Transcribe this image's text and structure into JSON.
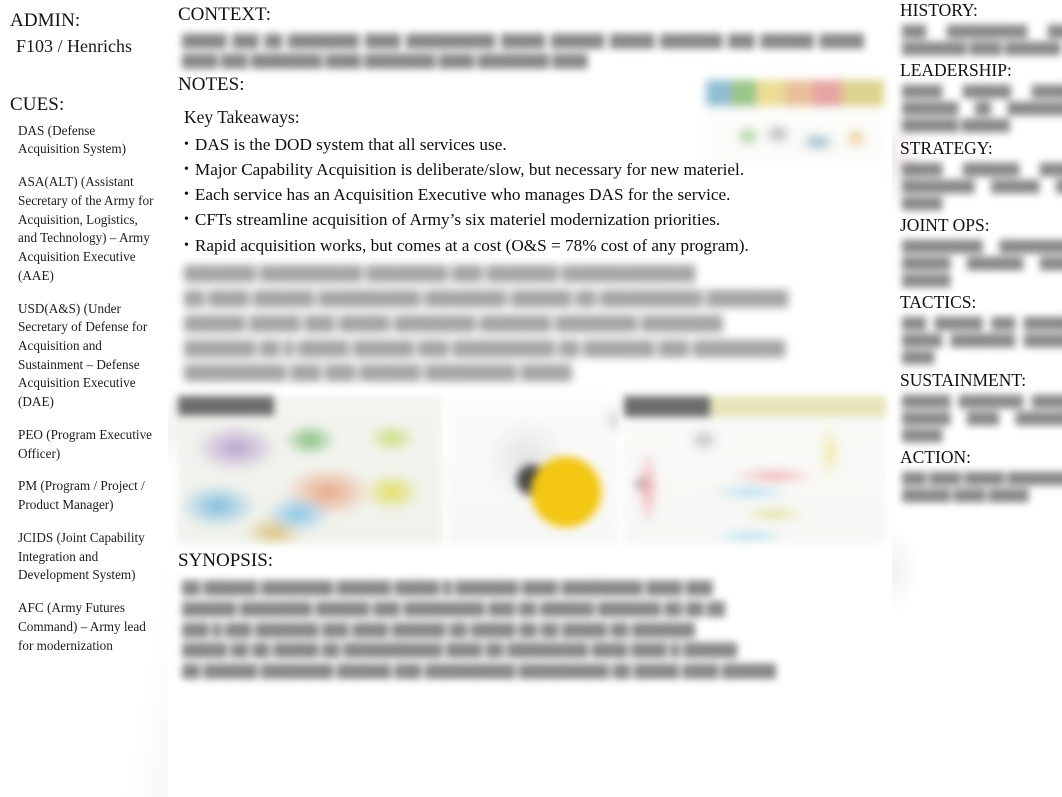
{
  "left": {
    "admin": {
      "header": "ADMIN:",
      "value": "F103 / Henrichs"
    },
    "cues": {
      "header": "CUES:",
      "items": [
        "DAS (Defense Acquisition System)",
        "ASA(ALT) (Assistant Secretary of the Army for Acquisition, Logistics, and Technology) – Army Acquisition Executive (AAE)",
        "USD(A&S) (Under Secretary of Defense for Acquisition and Sustainment – Defense Acquisition Executive (DAE)",
        "PEO (Program Executive Officer)",
        "PM (Program / Project / Product Manager)",
        "JCIDS (Joint Capability Integration and Development System)",
        "AFC (Army Futures Command) – Army lead for modernization"
      ]
    }
  },
  "main": {
    "context": {
      "header": "CONTEXT:",
      "body_redacted": "█████ ███ ██ ████████ ████ ██████████ █████ ██████ █████ ███████ ███ ██████ █████ ████ ███ ████████ ████ ████████ ████ ████████ ████"
    },
    "notes": {
      "header": "NOTES:",
      "takeaways_title": "Key Takeaways:",
      "bullet_glyph": "•",
      "takeaways": [
        "DAS is the DOD system that all services use.",
        "Major Capability Acquisition is deliberate/slow, but necessary for new materiel.",
        "Each service has an Acquisition Executive who manages DAS for the service.",
        "CFTs streamline acquisition of Army’s six materiel modernization priorities.",
        "Rapid acquisition works, but comes at a cost (O&S = 78% cost of any program)."
      ],
      "body_redacted_lines": [
        "███████ ██████████ ████████ ███ ███████ █████████████",
        "██ ████ ██████ ██████████ ████████ ██████ ██ ██████████ ████████",
        "██████ █████ ███ █████ ████████ ███████ ████████ ████████",
        "███████ ██ █ █████ ██████ ███ ██████████ ██ ███████ ███ █████████",
        "██████████ ███ ███ ██████ █████████ █████"
      ]
    },
    "thumbnails": [
      {
        "name": "acquisition-process-diagram-thumbnail"
      },
      {
        "name": "circular-lifecycle-diagram-thumbnail"
      },
      {
        "name": "acquisition-framework-chart-thumbnail"
      }
    ],
    "notes_image": {
      "name": "acquisition-pathways-banner-thumbnail"
    },
    "synopsis": {
      "header": "SYNOPSIS:",
      "body_redacted_lines": [
        "██ ██████ ████████ ██████ █████ █ ███████ ████ █████████ ████ ███",
        "██████ ████████ ██████ ███ █████████ ███ ██ ██████ ███████ ██ ██ ██",
        "███ █ ███ ███████ ███ ████ ██████ ██ █████ ██ ██ █████ ██ ███████",
        "█████ ██ ██ █████ ██ ███████████ ████ ██ █████████ ████ ████ █ ██████",
        "██ ██████ ████████ ██████ ███ ██████████ ██████████ ██ █████ ████ ██████"
      ]
    }
  },
  "right": {
    "sections": [
      {
        "header": "HISTORY:",
        "body_redacted": "███ ██████████ ███ ████████ ████ ███████"
      },
      {
        "header": "LEADERSHIP:",
        "body_redacted": "█████ ██████ █████ ███████ ██ ████████ ███████ ██████"
      },
      {
        "header": "STRATEGY:",
        "body_redacted": "█████ ███████ ████ █████████ ██████ ██ █████"
      },
      {
        "header": "JOINT OPS:",
        "body_redacted": "██████████ █████████ ██████ ███████ ████ ██████"
      },
      {
        "header": "TACTICS:",
        "body_redacted": "███ ██████ ███ ██████ █████ ████████ ██████ ████"
      },
      {
        "header": "SUSTAINMENT:",
        "body_redacted": "██████ ████████ █████ ██████ ████ ███████ █████"
      },
      {
        "header": "ACTION:",
        "body_redacted": "███ ████ █████ ████████ ██████ ████ █████"
      }
    ]
  }
}
